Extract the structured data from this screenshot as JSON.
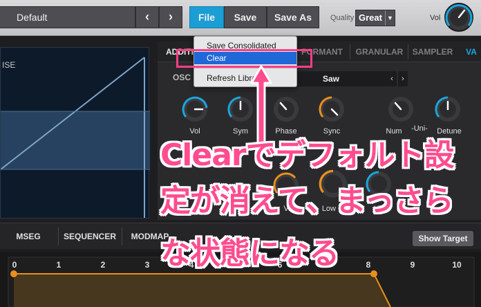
{
  "toolbar": {
    "preset_name": "Default",
    "prev_label": "‹",
    "next_label": "›",
    "file_label": "File",
    "save_label": "Save",
    "save_as_label": "Save As",
    "quality_label": "Quality",
    "quality_value": "Great",
    "vol_label": "Vol"
  },
  "file_menu": {
    "items": [
      "Save Consolidated",
      "Clear",
      "Refresh Library"
    ],
    "selected": "Clear"
  },
  "wave_panel": {
    "title": "ISE"
  },
  "tabs": [
    "ADDITIVE",
    "FORMANT",
    "GRANULAR",
    "SAMPLER",
    "VA"
  ],
  "osc": {
    "label": "OSC",
    "waveform": "Saw",
    "knobs": [
      "Vol",
      "Sym",
      "Phase",
      "Sync",
      "Num -Uni- Detune"
    ],
    "knob_labels": {
      "vol": "Vol",
      "sym": "Sym",
      "phase": "Phase",
      "sync": "Sync",
      "num": "Num",
      "uni": "-Uni-",
      "detune": "Detune"
    }
  },
  "filter_labels": {
    "vol2": "Vol",
    "low_cut": "Low Cut",
    "high": "High"
  },
  "bottom": {
    "tabs": [
      "MSEG",
      "SEQUENCER",
      "MODMAP"
    ],
    "show_target": "Show Target",
    "ticks": [
      "0",
      "1",
      "2",
      "3",
      "4",
      "5",
      "6",
      "7",
      "8",
      "9",
      "10"
    ]
  },
  "caption": {
    "line1": "Clearでデフォルト設",
    "line2": "定が消えて、まっさら",
    "line3": "な状態になる"
  },
  "colors": {
    "accent_blue": "#1a9ed4",
    "menu_select": "#2067d8",
    "annotation_pink": "#ff4c8f",
    "knob_orange": "#e8901c"
  }
}
